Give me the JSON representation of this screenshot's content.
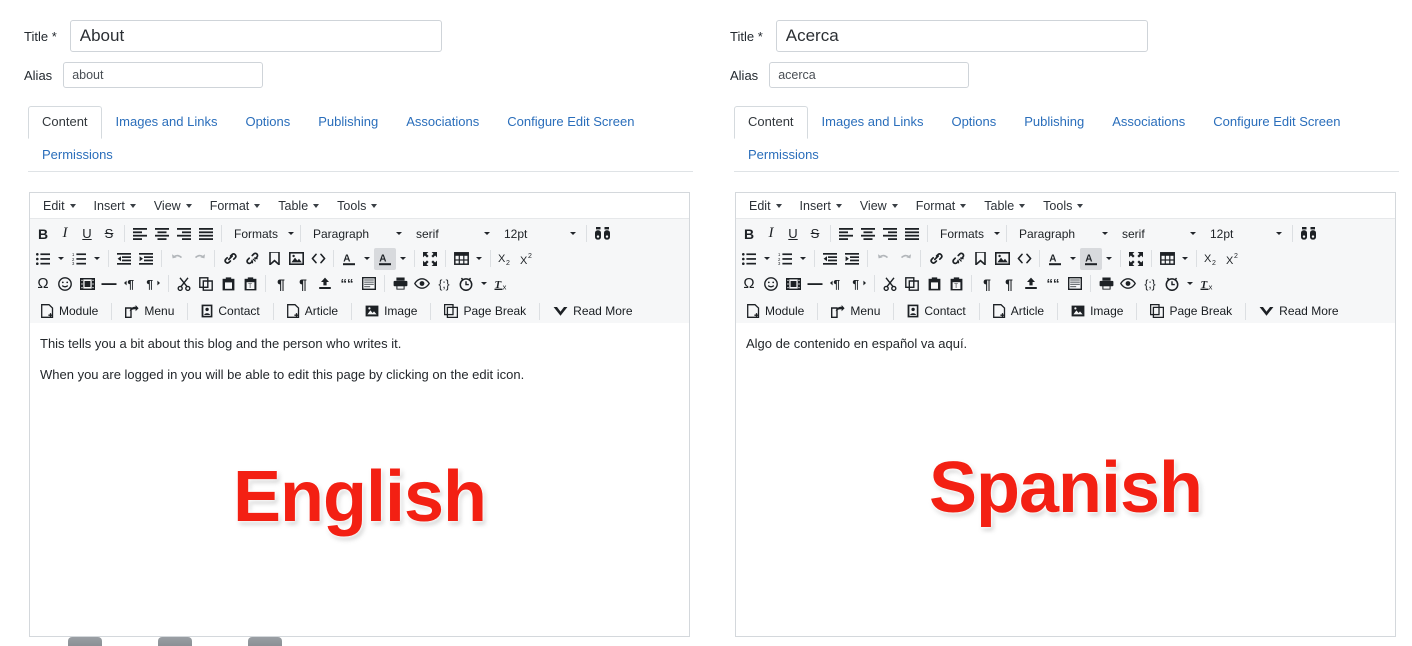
{
  "panels": [
    {
      "id": "english-panel",
      "form": {
        "title_label": "Title",
        "title_required": "*",
        "title_value": "About",
        "alias_label": "Alias",
        "alias_value": "about"
      },
      "tabs": [
        {
          "label": "Content",
          "active": true
        },
        {
          "label": "Images and Links",
          "active": false
        },
        {
          "label": "Options",
          "active": false
        },
        {
          "label": "Publishing",
          "active": false
        },
        {
          "label": "Associations",
          "active": false
        },
        {
          "label": "Configure Edit Screen",
          "active": false
        },
        {
          "label": "Permissions",
          "active": false
        }
      ],
      "content": {
        "paragraphs": [
          "This tells you a bit about this blog and the person who writes it.",
          "When you are logged in you will be able to edit this page by clicking on the edit icon."
        ],
        "banner": "English"
      }
    },
    {
      "id": "spanish-panel",
      "form": {
        "title_label": "Title",
        "title_required": "*",
        "title_value": "Acerca",
        "alias_label": "Alias",
        "alias_value": "acerca"
      },
      "tabs": [
        {
          "label": "Content",
          "active": true
        },
        {
          "label": "Images and Links",
          "active": false
        },
        {
          "label": "Options",
          "active": false
        },
        {
          "label": "Publishing",
          "active": false
        },
        {
          "label": "Associations",
          "active": false
        },
        {
          "label": "Configure Edit Screen",
          "active": false
        },
        {
          "label": "Permissions",
          "active": false
        }
      ],
      "content": {
        "paragraphs": [
          "Algo de contenido en español va aquí."
        ],
        "banner": "Spanish"
      }
    }
  ],
  "editor": {
    "menubar": [
      "Edit",
      "Insert",
      "View",
      "Format",
      "Table",
      "Tools"
    ],
    "row1": {
      "bold": "B",
      "italic": "I",
      "underline": "U",
      "strikethrough": "S",
      "formats_label": "Formats",
      "block_label": "Paragraph",
      "font_label": "serif",
      "size_label": "12pt"
    },
    "row4_buttons": [
      {
        "label": "Module",
        "icon": "module-icon"
      },
      {
        "label": "Menu",
        "icon": "menu-share-icon"
      },
      {
        "label": "Contact",
        "icon": "contact-card-icon"
      },
      {
        "label": "Article",
        "icon": "article-icon"
      },
      {
        "label": "Image",
        "icon": "image-icon"
      },
      {
        "label": "Page Break",
        "icon": "page-break-icon"
      },
      {
        "label": "Read More",
        "icon": "read-more-icon"
      }
    ]
  },
  "colors": {
    "link": "#2a6ebb",
    "banner_red": "#f32013",
    "toolbar_bg": "#f6f7f8",
    "border": "#d4d8dc"
  }
}
